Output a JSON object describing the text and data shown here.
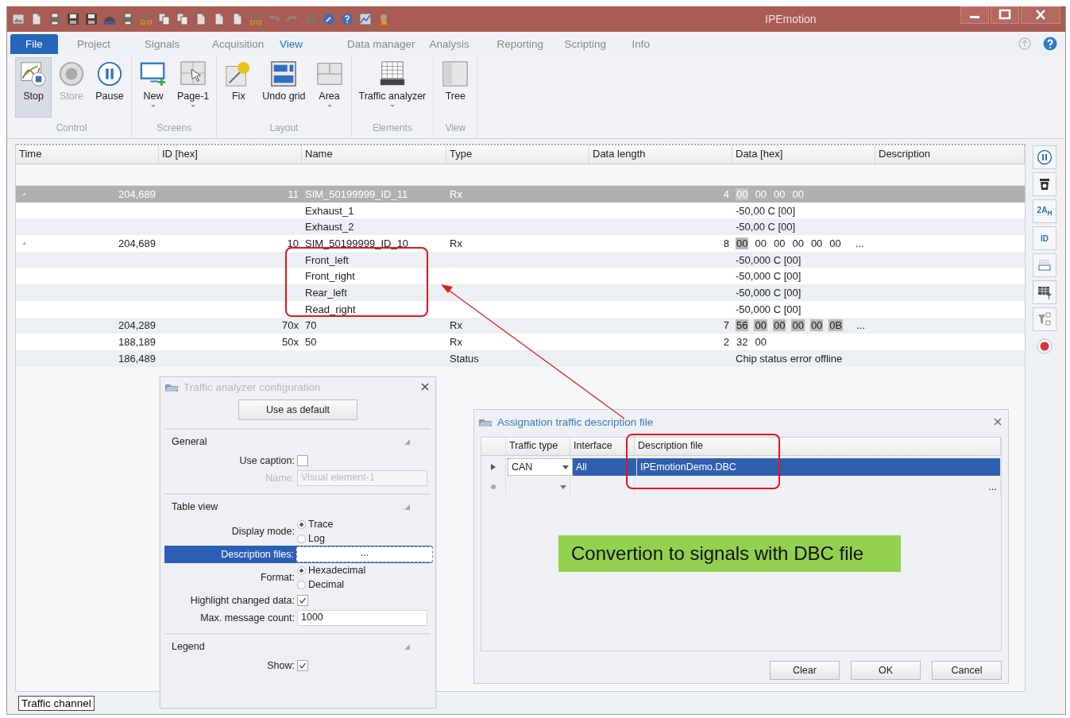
{
  "window": {
    "title": "IPEmotion"
  },
  "tabs": [
    {
      "label": "File",
      "kind": "file",
      "selected": false
    },
    {
      "label": "Project",
      "kind": "tab",
      "selected": false
    },
    {
      "label": "Signals",
      "kind": "tab",
      "selected": false
    },
    {
      "label": "Acquisition",
      "kind": "tab",
      "selected": false
    },
    {
      "label": "View",
      "kind": "tab",
      "selected": true
    },
    {
      "label": "Data manager",
      "kind": "tab",
      "selected": false
    },
    {
      "label": "Analysis",
      "kind": "tab",
      "selected": false
    },
    {
      "label": "Reporting",
      "kind": "tab",
      "selected": false
    },
    {
      "label": "Scripting",
      "kind": "tab",
      "selected": false
    },
    {
      "label": "Info",
      "kind": "tab",
      "selected": false
    }
  ],
  "ribbon": [
    {
      "label": "Control",
      "buttons": [
        {
          "label": "Stop",
          "kind": "stop",
          "active": true,
          "disabled": false,
          "dropdown": false
        },
        {
          "label": "Store",
          "kind": "record",
          "active": false,
          "disabled": true,
          "dropdown": false
        },
        {
          "label": "Pause",
          "kind": "pause",
          "active": false,
          "disabled": false,
          "dropdown": false
        }
      ]
    },
    {
      "label": "Screens",
      "buttons": [
        {
          "label": "New",
          "kind": "monitor",
          "active": false,
          "disabled": false,
          "dropdown": true
        },
        {
          "label": "Page-1",
          "kind": "page",
          "active": false,
          "disabled": false,
          "dropdown": true
        }
      ]
    },
    {
      "label": "Layout",
      "buttons": [
        {
          "label": "Fix",
          "kind": "pin",
          "active": false,
          "disabled": false,
          "dropdown": false
        },
        {
          "label": "Undo grid",
          "kind": "grid",
          "active": false,
          "disabled": false,
          "dropdown": false
        },
        {
          "label": "Area",
          "kind": "area",
          "active": false,
          "disabled": false,
          "dropdown": true
        }
      ]
    },
    {
      "label": "Elements",
      "buttons": [
        {
          "label": "Traffic analyzer",
          "kind": "traffic",
          "active": false,
          "disabled": false,
          "dropdown": true
        }
      ]
    },
    {
      "label": "View",
      "buttons": [
        {
          "label": "Tree",
          "kind": "tree",
          "active": false,
          "disabled": false,
          "dropdown": false
        }
      ]
    }
  ],
  "table": {
    "columns": [
      "Time",
      "ID [hex]",
      "Name",
      "Type",
      "Data length",
      "Data [hex]",
      "Description"
    ],
    "rows": [
      {
        "kind": "message",
        "expanded": true,
        "selected": true,
        "time": "204,689",
        "id": "11",
        "name": "SIM_50199999_ID_11",
        "type": "Rx",
        "length": "4",
        "bytes": [
          {
            "value": "00",
            "changed": true
          },
          {
            "value": "00",
            "changed": false
          },
          {
            "value": "00",
            "changed": false
          },
          {
            "value": "00",
            "changed": false
          }
        ]
      },
      {
        "kind": "signal",
        "name": "Exhaust_1",
        "value": "-50,00 C [00]"
      },
      {
        "kind": "signal",
        "name": "Exhaust_2",
        "value": "-50,00 C [00]"
      },
      {
        "kind": "message",
        "expanded": true,
        "selected": false,
        "time": "204,689",
        "id": "10",
        "name": "SIM_50199999_ID_10",
        "type": "Rx",
        "length": "8",
        "bytes": [
          {
            "value": "00",
            "changed": true
          },
          {
            "value": "00",
            "changed": false
          },
          {
            "value": "00",
            "changed": false
          },
          {
            "value": "00",
            "changed": false
          },
          {
            "value": "00",
            "changed": false
          },
          {
            "value": "00",
            "changed": false
          }
        ],
        "overflow": "..."
      },
      {
        "kind": "signal",
        "name": "Front_left",
        "value": "-50,000 C [00]"
      },
      {
        "kind": "signal",
        "name": "Front_right",
        "value": "-50,000 C [00]"
      },
      {
        "kind": "signal",
        "name": "Rear_left",
        "value": "-50,000 C [00]"
      },
      {
        "kind": "signal",
        "name": "Read_right",
        "value": "-50,000 C [00]"
      },
      {
        "kind": "message",
        "selected": false,
        "time": "204,289",
        "id": "70x",
        "name": "70",
        "type": "Rx",
        "length": "7",
        "bytes": [
          {
            "value": "56",
            "changed": true
          },
          {
            "value": "00",
            "changed": true
          },
          {
            "value": "00",
            "changed": true
          },
          {
            "value": "00",
            "changed": true
          },
          {
            "value": "00",
            "changed": true
          },
          {
            "value": "0B",
            "changed": true
          }
        ],
        "overflow": "..."
      },
      {
        "kind": "message",
        "selected": false,
        "time": "188,189",
        "id": "50x",
        "name": "50",
        "type": "Rx",
        "length": "2",
        "bytes": [
          {
            "value": "32",
            "changed": false
          },
          {
            "value": "00",
            "changed": false
          }
        ]
      },
      {
        "kind": "status",
        "time": "186,489",
        "type": "Status",
        "value": "Chip status error offline"
      }
    ]
  },
  "side_labels": [
    "2A$_{H}$",
    "ID"
  ],
  "config_panel": {
    "title": "Traffic analyzer configuration",
    "default_button": "Use as default",
    "sections": [
      {
        "title": "General",
        "fields": [
          {
            "kind": "checkbox",
            "label": "Use caption:",
            "checked": false
          },
          {
            "kind": "text",
            "label": "Name:",
            "value": "Visual element-1",
            "disabled": true
          }
        ]
      },
      {
        "title": "Table view",
        "fields": [
          {
            "kind": "radio",
            "label": "Display mode:",
            "options": [
              {
                "label": "Trace",
                "selected": true
              },
              {
                "label": "Log",
                "selected": false
              }
            ]
          },
          {
            "kind": "picker",
            "label": "Description files:",
            "value": "...",
            "selected": true
          },
          {
            "kind": "radio",
            "label": "Format:",
            "options": [
              {
                "label": "Hexadecimal",
                "selected": true
              },
              {
                "label": "Decimal",
                "selected": false
              }
            ]
          },
          {
            "kind": "checkbox",
            "label": "Highlight changed data:",
            "checked": true
          },
          {
            "kind": "text",
            "label": "Max. message count:",
            "value": "1000",
            "disabled": false
          }
        ]
      },
      {
        "title": "Legend",
        "fields": [
          {
            "kind": "checkbox",
            "label": "Show:",
            "checked": true
          }
        ]
      }
    ]
  },
  "dialog": {
    "title": "Assignation traffic description file",
    "columns": [
      "Traffic type",
      "Interface",
      "Description file"
    ],
    "rows": [
      {
        "kind": "entry",
        "selected": true,
        "traffic_type": "CAN",
        "interface": "All",
        "file": "IPEmotionDemo.DBC"
      },
      {
        "kind": "new",
        "selected": false,
        "browse": "..."
      }
    ],
    "buttons": [
      "Clear",
      "OK",
      "Cancel"
    ]
  },
  "callout": "Convertion to signals with DBC file",
  "bottom_tab": "Traffic channel"
}
